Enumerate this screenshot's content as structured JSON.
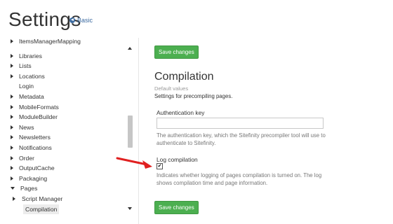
{
  "header": {
    "title": "Settings",
    "mode_link": "Basic"
  },
  "sidebar": {
    "items": [
      {
        "label": "ItemsManagerMapping",
        "expandable": true,
        "expanded": false,
        "indent": 0
      },
      {
        "label": "Libraries",
        "expandable": true,
        "expanded": false,
        "indent": 0
      },
      {
        "label": "Lists",
        "expandable": true,
        "expanded": false,
        "indent": 0
      },
      {
        "label": "Locations",
        "expandable": true,
        "expanded": false,
        "indent": 0
      },
      {
        "label": "Login",
        "expandable": false,
        "expanded": false,
        "indent": 0
      },
      {
        "label": "Metadata",
        "expandable": true,
        "expanded": false,
        "indent": 0
      },
      {
        "label": "MobileFormats",
        "expandable": true,
        "expanded": false,
        "indent": 0
      },
      {
        "label": "ModuleBuilder",
        "expandable": true,
        "expanded": false,
        "indent": 0
      },
      {
        "label": "News",
        "expandable": true,
        "expanded": false,
        "indent": 0
      },
      {
        "label": "Newsletters",
        "expandable": true,
        "expanded": false,
        "indent": 0
      },
      {
        "label": "Notifications",
        "expandable": true,
        "expanded": false,
        "indent": 0
      },
      {
        "label": "Order",
        "expandable": true,
        "expanded": false,
        "indent": 0
      },
      {
        "label": "OutputCache",
        "expandable": true,
        "expanded": false,
        "indent": 0
      },
      {
        "label": "Packaging",
        "expandable": true,
        "expanded": false,
        "indent": 0
      },
      {
        "label": "Pages",
        "expandable": true,
        "expanded": true,
        "indent": 0
      },
      {
        "label": "Script Manager",
        "expandable": true,
        "expanded": false,
        "indent": 1
      },
      {
        "label": "Compilation",
        "expandable": false,
        "expanded": false,
        "indent": 1,
        "selected": true
      }
    ]
  },
  "main": {
    "save_label_top": "Save changes",
    "section_title": "Compilation",
    "section_subtitle": "Default values",
    "section_description": "Settings for precompiling pages.",
    "auth_key": {
      "label": "Authentication key",
      "value": "",
      "help": "The authentication key, which the Sitefinity precompiler tool will use to authenticate to Sitefinity."
    },
    "log_compilation": {
      "label": "Log compilation",
      "checked": true,
      "help": "Indicates whether logging of pages compilation is turned on. The log shows compilation time and page information."
    },
    "save_label_bottom": "Save changes"
  },
  "colors": {
    "save_button": "#4caf50",
    "link": "#3b6aa0",
    "annotation_arrow": "#e02020"
  }
}
